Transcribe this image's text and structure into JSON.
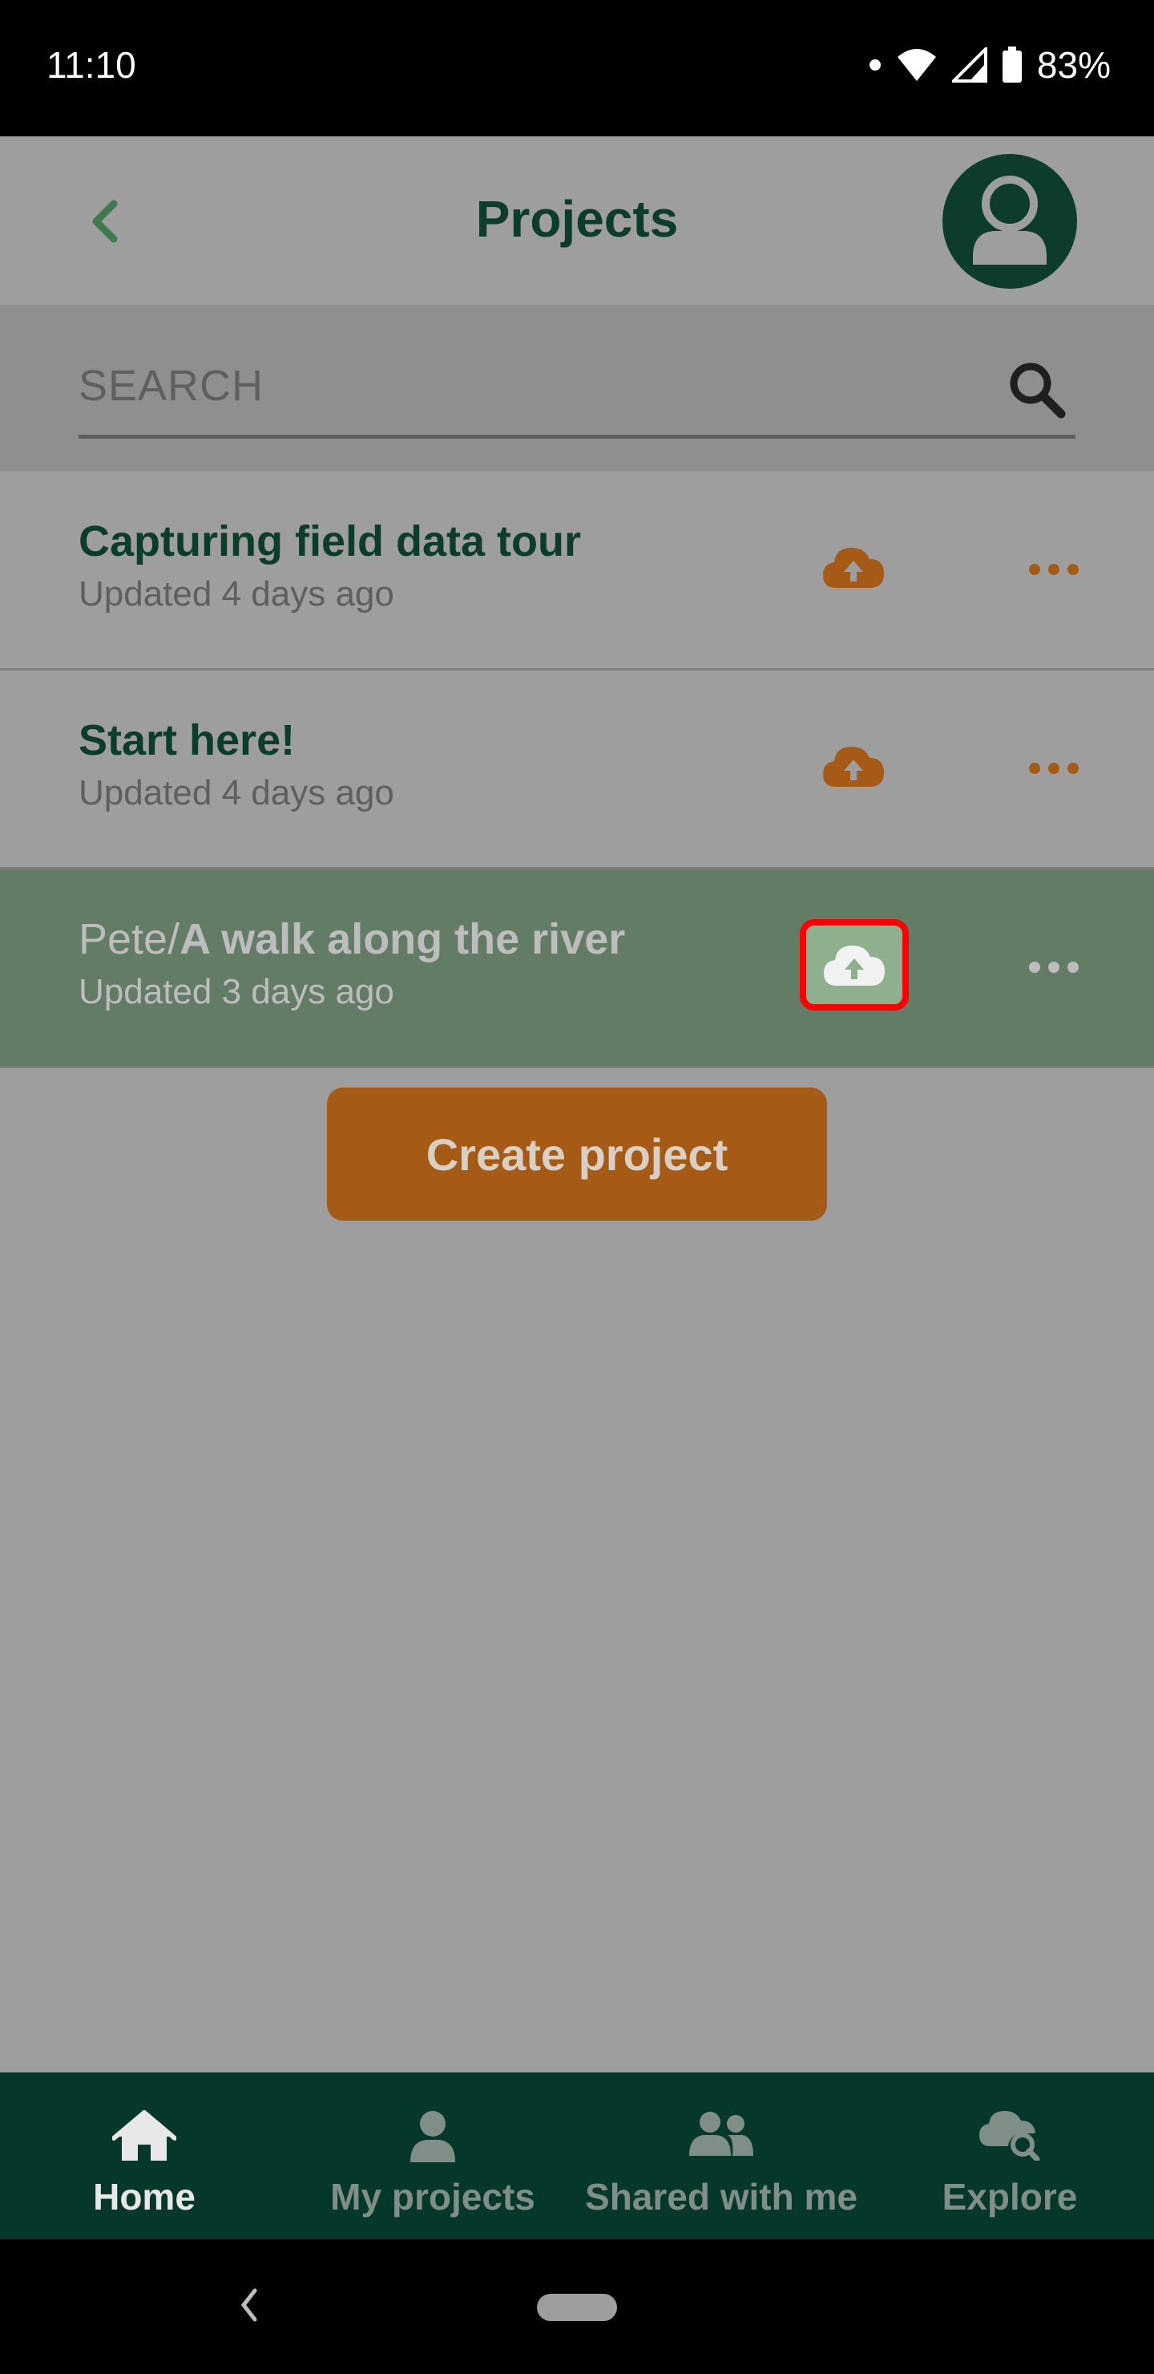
{
  "status_bar": {
    "time": "11:10",
    "battery": "83%"
  },
  "header": {
    "title": "Projects"
  },
  "search": {
    "placeholder": "SEARCH"
  },
  "projects": [
    {
      "owner": "",
      "name": "Capturing field data tour",
      "updated": "Updated 4 days ago",
      "selected": false
    },
    {
      "owner": "",
      "name": "Start here!",
      "updated": "Updated 4 days ago",
      "selected": false
    },
    {
      "owner": "Pete/",
      "name": "A walk along the river",
      "updated": "Updated 3 days ago",
      "selected": true
    }
  ],
  "create_button": {
    "label": "Create project"
  },
  "bottom_nav": [
    {
      "label": "Home",
      "icon": "home-icon",
      "active": true
    },
    {
      "label": "My projects",
      "icon": "person-icon",
      "active": false
    },
    {
      "label": "Shared with me",
      "icon": "people-icon",
      "active": false
    },
    {
      "label": "Explore",
      "icon": "cloud-search-icon",
      "active": false
    }
  ],
  "colors": {
    "primary_dark": "#0b3d2a",
    "accent_orange": "#a55b16",
    "selected_row": "#627c65",
    "highlight": "#ff0000"
  }
}
